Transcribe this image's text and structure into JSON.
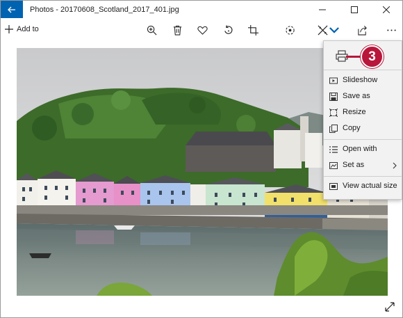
{
  "window": {
    "title": "Photos - 20170608_Scotland_2017_401.jpg"
  },
  "toolbar": {
    "add_to_label": "Add to",
    "icons": [
      "zoom-in-icon",
      "delete-icon",
      "favorite-icon",
      "rotate-icon",
      "crop-icon",
      "enhance-icon",
      "edit-icon",
      "share-icon",
      "more-icon"
    ]
  },
  "menu": {
    "items": [
      {
        "label": "Slideshow",
        "icon": "slideshow-icon"
      },
      {
        "label": "Save as",
        "icon": "save-icon"
      },
      {
        "label": "Resize",
        "icon": "resize-icon"
      },
      {
        "label": "Copy",
        "icon": "copy-icon"
      },
      {
        "label": "Open with",
        "icon": "open-with-icon"
      },
      {
        "label": "Set as",
        "icon": "set-as-icon"
      },
      {
        "label": "View actual size",
        "icon": "actual-size-icon"
      }
    ]
  },
  "callout": {
    "number": "3"
  },
  "colors": {
    "accent": "#0063b1",
    "callout": "#b8163a"
  }
}
